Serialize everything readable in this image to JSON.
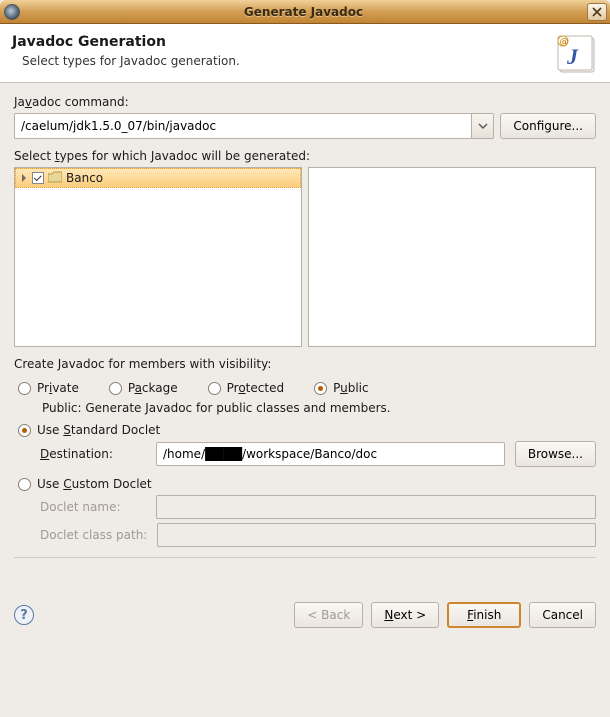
{
  "window": {
    "title": "Generate Javadoc"
  },
  "banner": {
    "heading": "Javadoc Generation",
    "subtitle": "Select types for Javadoc generation."
  },
  "javadoc_command": {
    "label_pre": "Ja",
    "label_u": "v",
    "label_post": "adoc command:",
    "value": "/caelum/jdk1.5.0_07/bin/javadoc",
    "configure": "Configure..."
  },
  "select_types": {
    "label_pre": "Select ",
    "label_u": "t",
    "label_post": "ypes for which Javadoc will be generated:",
    "projects": [
      {
        "name": "Banco",
        "checked": true,
        "expanded": false
      }
    ]
  },
  "visibility": {
    "label": "Create Javadoc for members with visibility:",
    "options": {
      "private": {
        "label_pre": "Pr",
        "label_u": "i",
        "label_post": "vate"
      },
      "package": {
        "label_pre": "P",
        "label_u": "a",
        "label_post": "ckage"
      },
      "protected": {
        "label_pre": "Pr",
        "label_u": "o",
        "label_post": "tected"
      },
      "public": {
        "label_pre": "P",
        "label_u": "u",
        "label_post": "blic"
      }
    },
    "selected": "public",
    "description": "Public: Generate Javadoc for public classes and members."
  },
  "doclet": {
    "selected": "standard",
    "standard": {
      "label_pre": "Use ",
      "label_u": "S",
      "label_post": "tandard Doclet"
    },
    "destination": {
      "label_pre": "",
      "label_u": "D",
      "label_post": "estination:",
      "value": "/home/████/workspace/Banco/doc",
      "browse": "Browse..."
    },
    "custom": {
      "label_pre": "Use ",
      "label_u": "C",
      "label_post": "ustom Doclet"
    },
    "doclet_name": {
      "label": "Doclet name:",
      "value": ""
    },
    "doclet_classpath": {
      "label": "Doclet class path:",
      "value": ""
    }
  },
  "buttons": {
    "back": "< Back",
    "next_pre": "",
    "next_u": "N",
    "next_post": "ext >",
    "finish_pre": "",
    "finish_u": "F",
    "finish_post": "inish",
    "cancel": "Cancel"
  }
}
